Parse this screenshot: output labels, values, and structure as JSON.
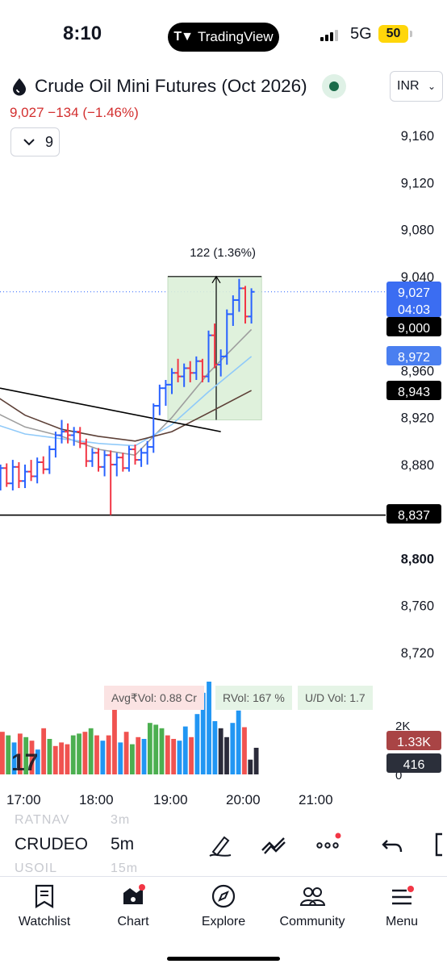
{
  "status_bar": {
    "time": "8:10",
    "app_pill": "TradingView",
    "network": "5G",
    "battery": "50"
  },
  "header": {
    "symbol_title": "Crude Oil Mini Futures (Oct 2026)",
    "currency": "INR",
    "last_price": "9,027",
    "change": "−134",
    "change_percent": "(−1.46%)",
    "indicator_count": "9"
  },
  "chart": {
    "price_axis": [
      "9,160",
      "9,120",
      "9,080",
      "9,040",
      "8,960",
      "8,920",
      "8,880",
      "8,800",
      "8,760",
      "8,720"
    ],
    "bold_tick": "8,800",
    "last_price_label": "9,027",
    "countdown": "04:03",
    "ma_labels": [
      "9,000",
      "8,972",
      "8,943"
    ],
    "horizontal_line_label": "8,837",
    "measure_label": "122 (1.36%)",
    "volume_axis": [
      "2K",
      "0"
    ],
    "volume_labels": [
      "1.33K",
      "416"
    ],
    "stats": {
      "avg_vol": "Avg₹Vol: 0.88 Cr",
      "rvol": "RVol: 167 %",
      "ud_vol": "U/D Vol: 1.7"
    },
    "time_axis": [
      "17:00",
      "18:00",
      "19:00",
      "20:00",
      "21:00"
    ],
    "colors": {
      "up": "#2962ff",
      "down": "#f23645",
      "vol_up": "#4caf50",
      "vol_down": "#f05350",
      "vol_blue": "#2196f3",
      "ma1": "#9e9e9e",
      "ma2": "#90caf9",
      "ma3": "#5d4037"
    }
  },
  "chart_data": {
    "type": "ohlc",
    "y_unit": "INR",
    "ylim": [
      8700,
      9170
    ],
    "x_range": [
      "16:25",
      "21:15"
    ],
    "interval": "5m",
    "bars": [
      {
        "t": "16:25",
        "o": 8870,
        "h": 8880,
        "l": 8855,
        "c": 8873
      },
      {
        "t": "16:30",
        "o": 8873,
        "h": 8885,
        "l": 8864,
        "c": 8878
      },
      {
        "t": "16:35",
        "o": 8878,
        "h": 8882,
        "l": 8858,
        "c": 8862
      },
      {
        "t": "16:40",
        "o": 8862,
        "h": 8880,
        "l": 8858,
        "c": 8877
      },
      {
        "t": "16:45",
        "o": 8877,
        "h": 8881,
        "l": 8861,
        "c": 8864
      },
      {
        "t": "16:50",
        "o": 8864,
        "h": 8884,
        "l": 8858,
        "c": 8878
      },
      {
        "t": "16:55",
        "o": 8878,
        "h": 8882,
        "l": 8860,
        "c": 8866
      },
      {
        "t": "17:00",
        "o": 8866,
        "h": 8880,
        "l": 8860,
        "c": 8874
      },
      {
        "t": "17:05",
        "o": 8874,
        "h": 8884,
        "l": 8866,
        "c": 8870
      },
      {
        "t": "17:10",
        "o": 8870,
        "h": 8886,
        "l": 8864,
        "c": 8882
      },
      {
        "t": "17:15",
        "o": 8882,
        "h": 8887,
        "l": 8872,
        "c": 8876
      },
      {
        "t": "17:20",
        "o": 8876,
        "h": 8896,
        "l": 8872,
        "c": 8893
      },
      {
        "t": "17:25",
        "o": 8893,
        "h": 8908,
        "l": 8886,
        "c": 8905
      },
      {
        "t": "17:30",
        "o": 8905,
        "h": 8918,
        "l": 8898,
        "c": 8908
      },
      {
        "t": "17:35",
        "o": 8908,
        "h": 8915,
        "l": 8898,
        "c": 8905
      },
      {
        "t": "17:40",
        "o": 8905,
        "h": 8912,
        "l": 8896,
        "c": 8908
      },
      {
        "t": "17:45",
        "o": 8908,
        "h": 8912,
        "l": 8894,
        "c": 8898
      },
      {
        "t": "17:50",
        "o": 8898,
        "h": 8902,
        "l": 8878,
        "c": 8883
      },
      {
        "t": "17:55",
        "o": 8883,
        "h": 8894,
        "l": 8878,
        "c": 8890
      },
      {
        "t": "18:00",
        "o": 8890,
        "h": 8894,
        "l": 8874,
        "c": 8878
      },
      {
        "t": "18:05",
        "o": 8878,
        "h": 8892,
        "l": 8870,
        "c": 8888
      },
      {
        "t": "18:10",
        "o": 8888,
        "h": 8892,
        "l": 8837,
        "c": 8880
      },
      {
        "t": "18:15",
        "o": 8880,
        "h": 8890,
        "l": 8870,
        "c": 8886
      },
      {
        "t": "18:20",
        "o": 8886,
        "h": 8890,
        "l": 8874,
        "c": 8877
      },
      {
        "t": "18:25",
        "o": 8877,
        "h": 8896,
        "l": 8874,
        "c": 8893
      },
      {
        "t": "18:30",
        "o": 8893,
        "h": 8897,
        "l": 8880,
        "c": 8884
      },
      {
        "t": "18:35",
        "o": 8884,
        "h": 8894,
        "l": 8878,
        "c": 8890
      },
      {
        "t": "18:40",
        "o": 8890,
        "h": 8900,
        "l": 8880,
        "c": 8895
      },
      {
        "t": "18:45",
        "o": 8895,
        "h": 8932,
        "l": 8890,
        "c": 8930
      },
      {
        "t": "18:50",
        "o": 8930,
        "h": 8948,
        "l": 8922,
        "c": 8945
      },
      {
        "t": "18:55",
        "o": 8945,
        "h": 8952,
        "l": 8930,
        "c": 8948
      },
      {
        "t": "19:00",
        "o": 8948,
        "h": 8962,
        "l": 8940,
        "c": 8958
      },
      {
        "t": "19:05",
        "o": 8958,
        "h": 8970,
        "l": 8950,
        "c": 8955
      },
      {
        "t": "19:10",
        "o": 8955,
        "h": 8966,
        "l": 8946,
        "c": 8962
      },
      {
        "t": "19:15",
        "o": 8962,
        "h": 8968,
        "l": 8950,
        "c": 8958
      },
      {
        "t": "19:20",
        "o": 8958,
        "h": 8972,
        "l": 8952,
        "c": 8968
      },
      {
        "t": "19:25",
        "o": 8968,
        "h": 8970,
        "l": 8950,
        "c": 8955
      },
      {
        "t": "19:30",
        "o": 8955,
        "h": 8994,
        "l": 8950,
        "c": 8990
      },
      {
        "t": "19:35",
        "o": 8990,
        "h": 9000,
        "l": 8962,
        "c": 8965
      },
      {
        "t": "19:40",
        "o": 8965,
        "h": 8978,
        "l": 8955,
        "c": 8972
      },
      {
        "t": "19:45",
        "o": 8972,
        "h": 9012,
        "l": 8965,
        "c": 9008
      },
      {
        "t": "19:50",
        "o": 9008,
        "h": 9024,
        "l": 8998,
        "c": 9020
      },
      {
        "t": "19:55",
        "o": 9020,
        "h": 9038,
        "l": 9010,
        "c": 9030
      },
      {
        "t": "20:00",
        "o": 9030,
        "h": 9032,
        "l": 9000,
        "c": 9006
      },
      {
        "t": "20:05",
        "o": 9006,
        "h": 9030,
        "l": 9000,
        "c": 9027
      }
    ],
    "moving_averages": [
      {
        "name": "",
        "color": "#9e9e9e",
        "points": [
          [
            "16:25",
            8930
          ],
          [
            "17:00",
            8912
          ],
          [
            "17:30",
            8904
          ],
          [
            "18:00",
            8893
          ],
          [
            "18:30",
            8888
          ],
          [
            "19:00",
            8920
          ],
          [
            "19:30",
            8958
          ],
          [
            "20:05",
            8995
          ]
        ]
      },
      {
        "name": "",
        "color": "#90caf9",
        "points": [
          [
            "16:25",
            8918
          ],
          [
            "17:00",
            8906
          ],
          [
            "17:30",
            8902
          ],
          [
            "18:00",
            8898
          ],
          [
            "18:30",
            8896
          ],
          [
            "19:00",
            8914
          ],
          [
            "19:30",
            8942
          ],
          [
            "20:05",
            8972
          ]
        ]
      },
      {
        "name": "",
        "color": "#5d4037",
        "points": [
          [
            "16:25",
            8946
          ],
          [
            "17:00",
            8922
          ],
          [
            "17:30",
            8910
          ],
          [
            "18:00",
            8904
          ],
          [
            "18:30",
            8900
          ],
          [
            "19:00",
            8908
          ],
          [
            "19:30",
            8924
          ],
          [
            "20:05",
            8943
          ]
        ]
      }
    ],
    "trendlines": [
      {
        "from": [
          "16:25",
          8945
        ],
        "to": [
          "19:40",
          8908
        ]
      },
      {
        "from": [
          "16:25",
          8837
        ],
        "to": [
          "21:15",
          8837
        ]
      }
    ],
    "measure": {
      "from_time": "19:00",
      "to_time": "20:10",
      "low": 8918,
      "high": 9040,
      "label": "122 (1.36%)"
    },
    "volume": {
      "ylim": [
        0,
        2500
      ],
      "values": [
        1200,
        1100,
        900,
        1150,
        1050,
        950,
        700,
        1300,
        1000,
        800,
        900,
        850,
        1100,
        1150,
        1200,
        1300,
        1100,
        950,
        1100,
        2300,
        900,
        1200,
        850,
        1050,
        1000,
        1450,
        1400,
        1300,
        1100,
        1000,
        950,
        1350,
        1050,
        1700,
        2300,
        3000,
        1500,
        1300,
        1050,
        1450,
        1800,
        1330,
        416,
        750
      ],
      "colors": [
        "#f05350",
        "#4caf50",
        "#2196f3",
        "#f05350",
        "#4caf50",
        "#f05350",
        "#2196f3",
        "#f05350",
        "#4caf50",
        "#f05350",
        "#f05350",
        "#f05350",
        "#4caf50",
        "#4caf50",
        "#f05350",
        "#4caf50",
        "#f05350",
        "#2196f3",
        "#f05350",
        "#f05350",
        "#2196f3",
        "#f05350",
        "#4caf50",
        "#f05350",
        "#2196f3",
        "#4caf50",
        "#4caf50",
        "#4caf50",
        "#f05350",
        "#f05350",
        "#2196f3",
        "#2196f3",
        "#f05350",
        "#2196f3",
        "#2196f3",
        "#2196f3",
        "#2196f3",
        "#2b2b3a",
        "#2b2b3a",
        "#2196f3",
        "#2196f3",
        "#f05350",
        "#2b2b3a",
        "#2b2b3a"
      ]
    }
  },
  "picker": {
    "ghost_top_symbol": "RATNAV",
    "ghost_top_interval": "3m",
    "symbol": "CRUDEO",
    "interval": "5m",
    "ghost_bottom_symbol": "USOIL",
    "ghost_bottom_interval": "15m"
  },
  "bottom_nav": [
    {
      "label": "Watchlist",
      "icon": "watchlist-icon"
    },
    {
      "label": "Chart",
      "icon": "chart-icon"
    },
    {
      "label": "Explore",
      "icon": "compass-icon"
    },
    {
      "label": "Community",
      "icon": "community-icon"
    },
    {
      "label": "Menu",
      "icon": "menu-icon"
    }
  ]
}
